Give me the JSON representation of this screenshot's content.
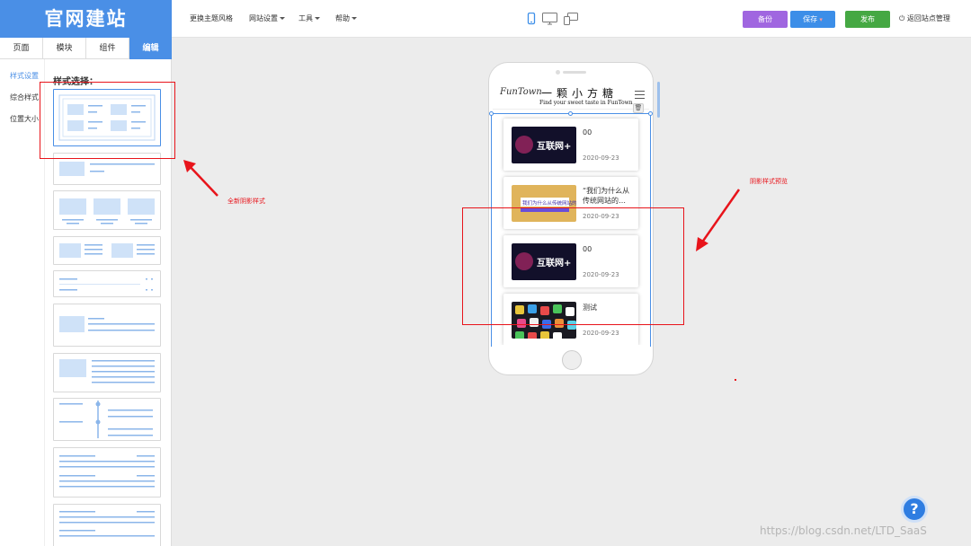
{
  "app": {
    "logo": "官网建站"
  },
  "topmenu": {
    "items": [
      {
        "label": "更换主题风格",
        "dropdown": false
      },
      {
        "label": "网站设置",
        "dropdown": true
      },
      {
        "label": "工具",
        "dropdown": true
      },
      {
        "label": "帮助",
        "dropdown": true
      }
    ]
  },
  "devices": {
    "icons": [
      "mobile-icon",
      "desktop-icon",
      "multi-device-icon"
    ],
    "active": "mobile-icon"
  },
  "actions": {
    "backup": "备份",
    "save": "保存",
    "publish": "发布",
    "return": "返回站点管理",
    "colors": {
      "backup": "#a066e0",
      "save": "#3c8ee8",
      "publish": "#45a843"
    }
  },
  "tabs": [
    {
      "label": "页面",
      "active": false
    },
    {
      "label": "模块",
      "active": false
    },
    {
      "label": "组件",
      "active": false
    },
    {
      "label": "编辑",
      "active": true
    }
  ],
  "subnav": [
    {
      "label": "样式设置",
      "active": true
    },
    {
      "label": "综合样式",
      "active": false
    },
    {
      "label": "位置大小",
      "active": false
    }
  ],
  "style_panel": {
    "title": "样式选择："
  },
  "site": {
    "signature": "FunTown",
    "title": "一颗小方糖",
    "subtitle": "Find your sweet taste in FunTown",
    "cards": [
      {
        "title": "00",
        "date": "2020-09-23",
        "image": "hulianwang-banner"
      },
      {
        "title": "“我们为什么从传统网站的…",
        "date": "2020-09-23",
        "image": "article-banner"
      },
      {
        "title": "00",
        "date": "2020-09-23",
        "image": "hulianwang-banner"
      },
      {
        "title": "测试",
        "date": "2020-09-23",
        "image": "apps-photo"
      }
    ],
    "banner_text": "互联网+",
    "article_banner_text": "我们为什么从传统网站的"
  },
  "annotations": {
    "left": "全新阴影样式",
    "right": "阴影样式预览",
    "color": "#e8141b"
  },
  "help": {
    "label": "?"
  },
  "watermark": "https://blog.csdn.net/LTD_SaaS"
}
